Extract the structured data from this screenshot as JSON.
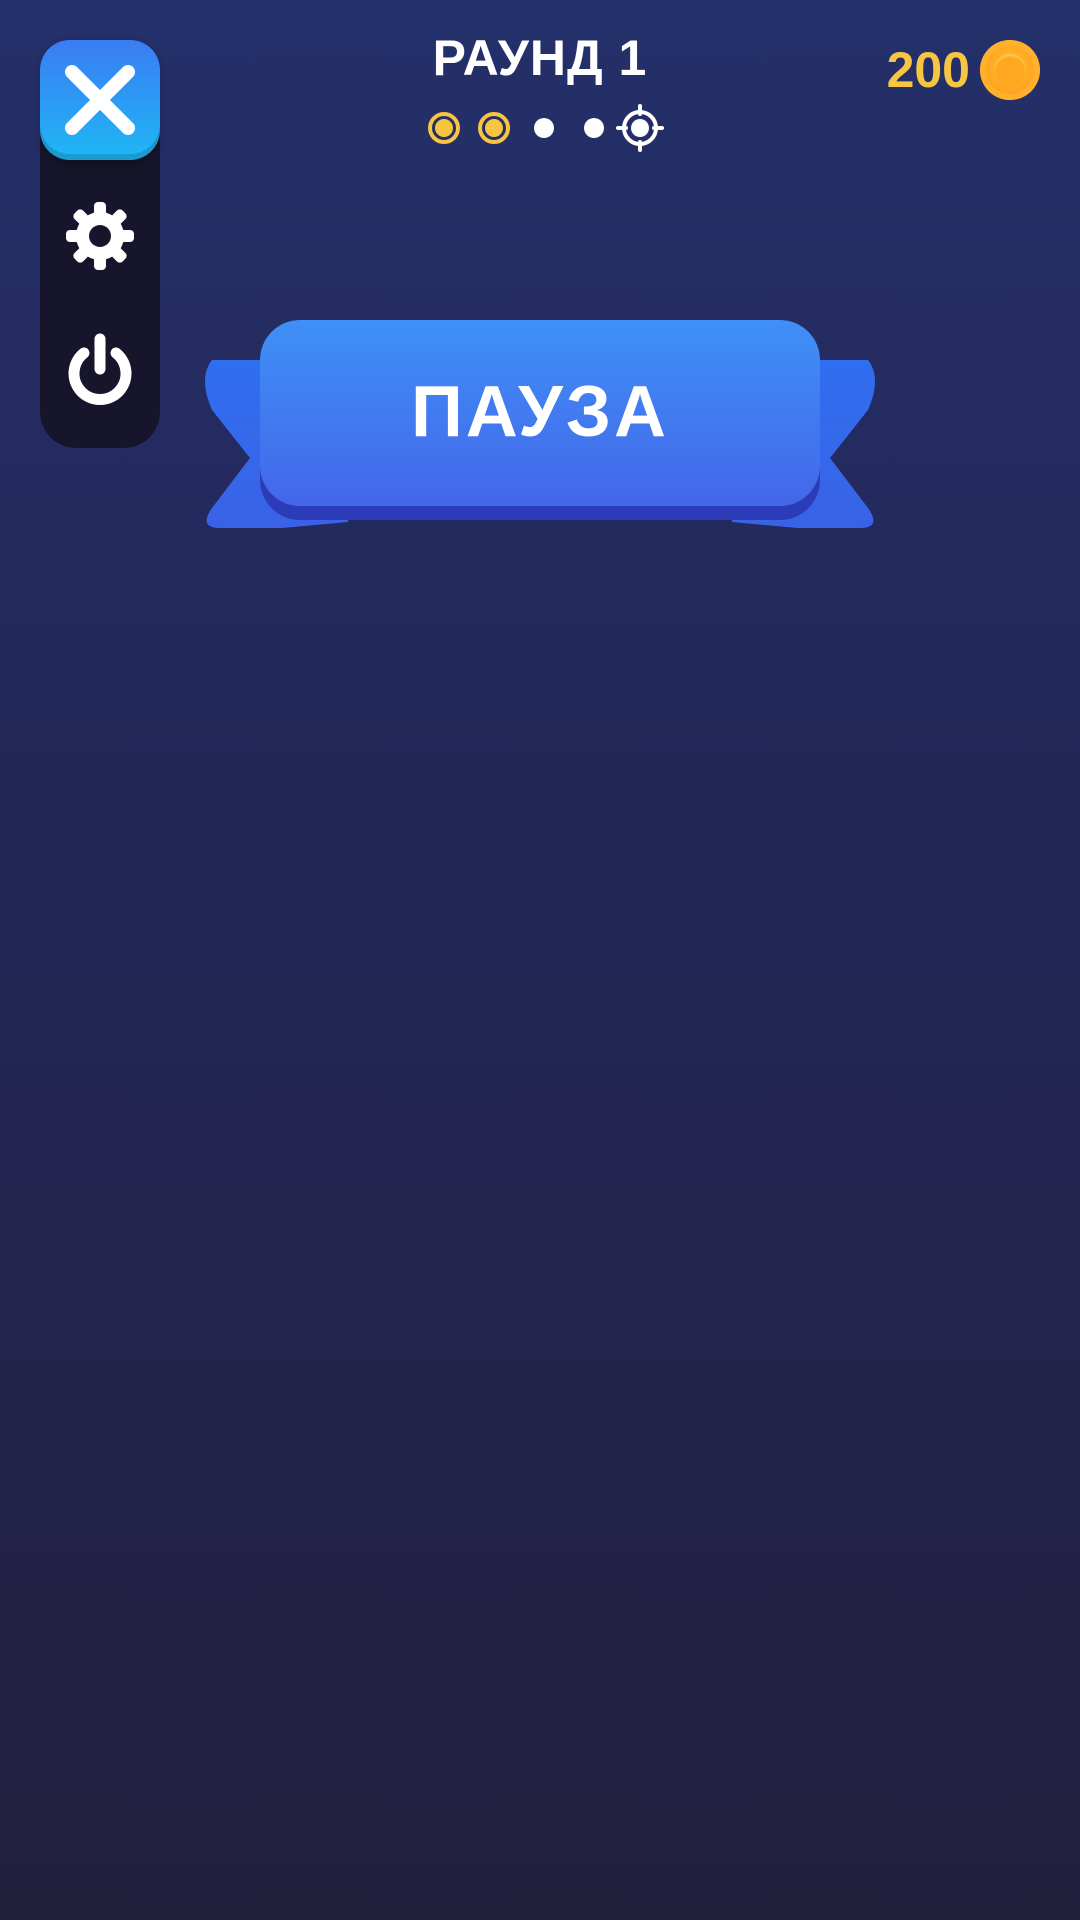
{
  "header": {
    "round_title": "РАУНД 1",
    "progress": {
      "steps_total": 5,
      "steps_completed": 2,
      "steps": [
        "completed",
        "completed",
        "pending",
        "pending",
        "target"
      ]
    },
    "coins": "200"
  },
  "side_menu": {
    "items": [
      "close-icon",
      "gear-icon",
      "power-icon"
    ]
  },
  "banner": {
    "title": "ПАУЗА"
  },
  "colors": {
    "background_top": "#24306a",
    "background_bottom": "#23203e",
    "panel": "#16152b",
    "accent_blue": "#3a7cf2",
    "coin_text": "#f7c541",
    "progress_gold": "#f7c541"
  }
}
